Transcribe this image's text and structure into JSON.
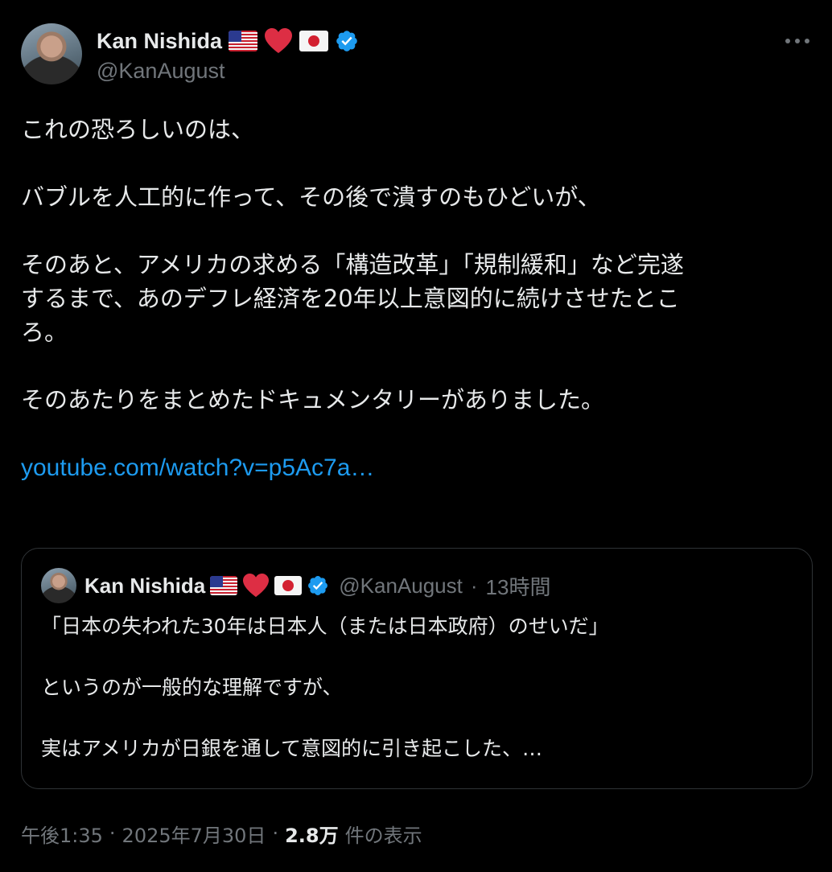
{
  "author": {
    "display_name": "Kan Nishida",
    "handle": "@KanAugust",
    "name_emoji": [
      "flag-us",
      "red-heart",
      "flag-jp"
    ],
    "verified": true,
    "avatar_icon": "profile-photo"
  },
  "more_icon": "ellipsis-icon",
  "tweet": {
    "paragraphs": [
      "これの恐ろしいのは、",
      "バブルを人工的に作って、その後で潰すのもひどいが、",
      "そのあと、アメリカの求める「構造改革」「規制緩和」など完遂\nするまで、あのデフレ経済を20年以上意図的に続けさせたとこ\nろ。",
      "そのあたりをまとめたドキュメンタリーがありました。"
    ],
    "link": "youtube.com/watch?v=p5Ac7a…"
  },
  "quoted_tweet": {
    "display_name": "Kan Nishida",
    "handle": "@KanAugust",
    "separator": "·",
    "time_ago": "13時間",
    "paragraphs": [
      "「日本の失われた30年は日本人（または日本政府）のせいだ」",
      "というのが一般的な理解ですが、",
      "実はアメリカが日銀を通して意図的に引き起こした、…"
    ]
  },
  "footer": {
    "time": "午後1:35",
    "separator": "·",
    "date": "2025年7月30日",
    "views_count": "2.8万",
    "views_label": "件の表示"
  },
  "colors": {
    "background": "#000000",
    "text": "#e7e9ea",
    "secondary": "#71767b",
    "link": "#1d9bf0",
    "border": "#2f3336",
    "verified": "#1d9bf0"
  }
}
